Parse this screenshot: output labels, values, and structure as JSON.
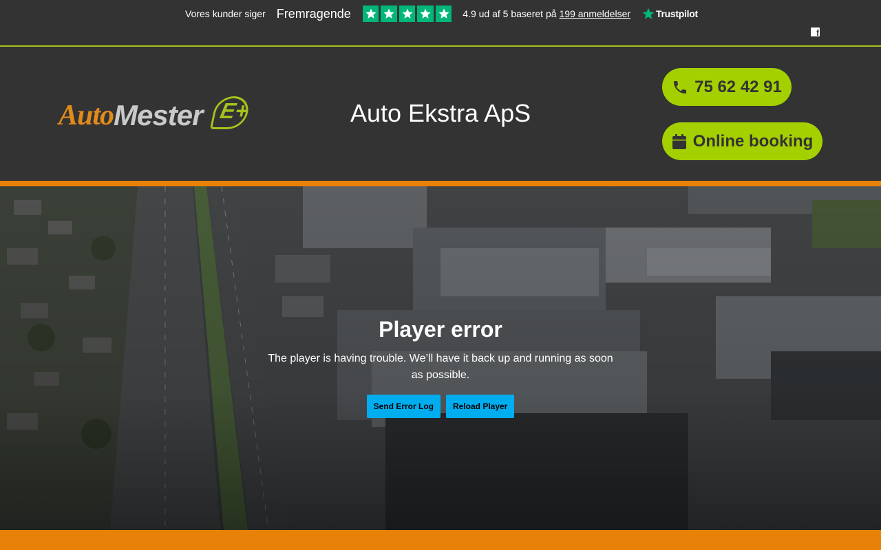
{
  "trustbar": {
    "customers_say": "Vores kunder siger",
    "rating_word": "Fremragende",
    "stars": 5,
    "score_text": "4.9 ud af 5 baseret på",
    "reviews_link": "199 anmeldelser",
    "provider": "Trustpilot",
    "star_color": "#00b67a"
  },
  "header": {
    "logo": {
      "part1": "Auto",
      "part2": "Mester",
      "part3": "E+"
    },
    "company_name": "Auto Ekstra ApS",
    "phone_label": "75 62 42 91",
    "booking_label": "Online booking",
    "accent_green": "#a4d000",
    "accent_orange": "#e88107"
  },
  "player": {
    "error_title": "Player error",
    "error_message": "The player is having trouble. We’ll have it back up and running as soon as possible.",
    "send_log_label": "Send Error Log",
    "reload_label": "Reload Player",
    "button_color": "#00adef"
  },
  "social": {
    "facebook_icon": "facebook-icon"
  }
}
